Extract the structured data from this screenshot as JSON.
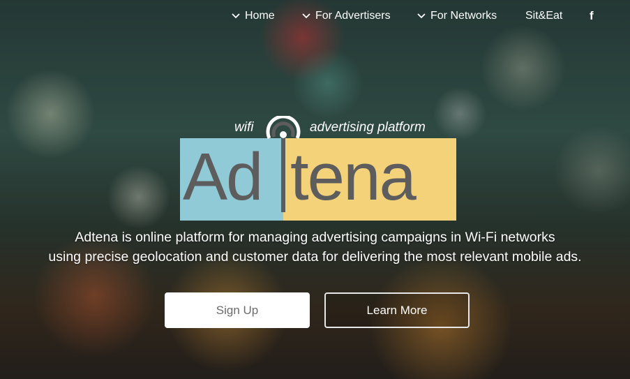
{
  "nav": {
    "home": "Home",
    "advertisers": "For Advertisers",
    "networks": "For Networks",
    "sit_eat": "Sit&Eat",
    "facebook_glyph": "f"
  },
  "logo": {
    "tagline_left": "wifi",
    "tagline_right": "advertising platform",
    "word_left": "Ad",
    "word_right": "tena",
    "colors": {
      "blue": "#8fcad6",
      "yellow": "#f4d27a",
      "text": "#5d5d5d"
    }
  },
  "hero": {
    "line1": "Adtena is online platform for managing advertising campaigns in Wi-Fi networks",
    "line2": "using precise geolocation and customer data for delivering the most relevant mobile ads."
  },
  "buttons": {
    "signup": "Sign Up",
    "learn_more": "Learn More"
  }
}
